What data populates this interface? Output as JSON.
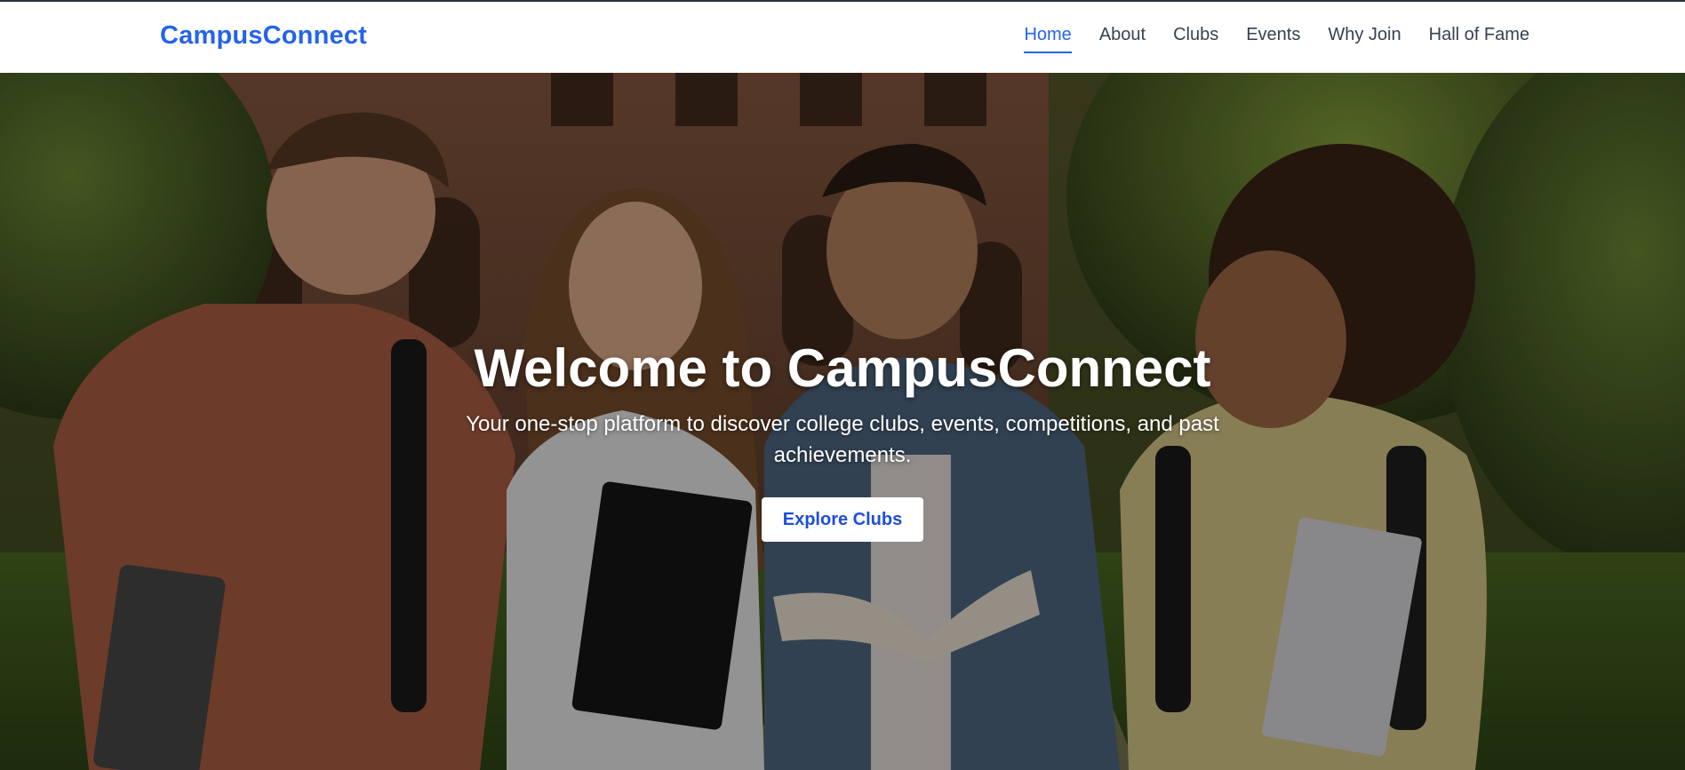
{
  "nav": {
    "brand": "CampusConnect",
    "links": [
      {
        "label": "Home",
        "active": true
      },
      {
        "label": "About",
        "active": false
      },
      {
        "label": "Clubs",
        "active": false
      },
      {
        "label": "Events",
        "active": false
      },
      {
        "label": "Why Join",
        "active": false
      },
      {
        "label": "Hall of Fame",
        "active": false
      }
    ]
  },
  "hero": {
    "title": "Welcome to CampusConnect",
    "subtitle": "Your one-stop platform to discover college clubs, events, competitions, and past achievements.",
    "button_label": "Explore Clubs",
    "image": "students-walking-on-campus-photo"
  },
  "colors": {
    "accent": "#2563eb",
    "nav_text": "#374151",
    "button_text": "#1d4ed8"
  }
}
